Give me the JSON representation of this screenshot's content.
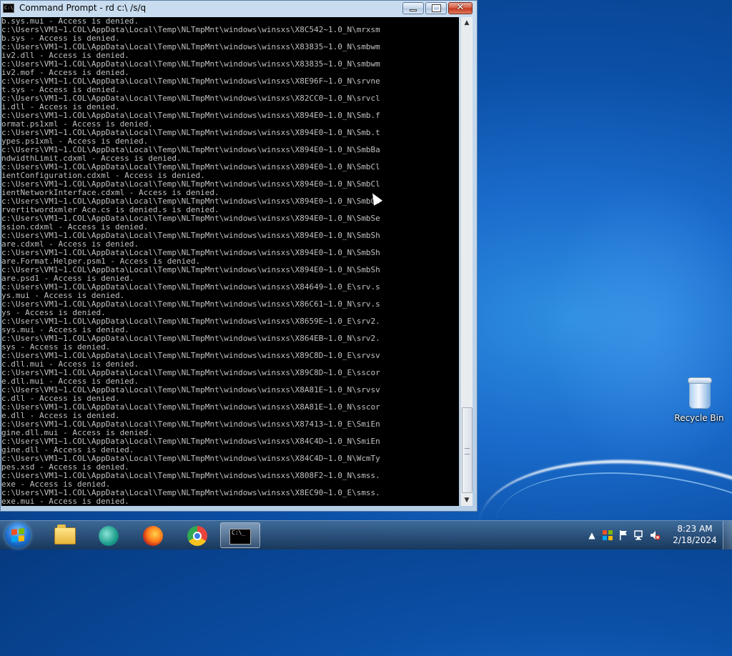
{
  "window": {
    "title": "Command Prompt - rd  c:\\ /s/q",
    "icon_name": "cmd-icon",
    "icon_text": "C:\\_"
  },
  "console": {
    "lines": [
      "b.sys.mui - Access is denied.",
      "c:\\Users\\VM1~1.COL\\AppData\\Local\\Temp\\NLTmpMnt\\windows\\winsxs\\X8C542~1.0_N\\mrxsm",
      "b.sys - Access is denied.",
      "c:\\Users\\VM1~1.COL\\AppData\\Local\\Temp\\NLTmpMnt\\windows\\winsxs\\X83835~1.0_N\\smbwm",
      "iv2.dll - Access is denied.",
      "c:\\Users\\VM1~1.COL\\AppData\\Local\\Temp\\NLTmpMnt\\windows\\winsxs\\X83835~1.0_N\\smbwm",
      "iv2.mof - Access is denied.",
      "c:\\Users\\VM1~1.COL\\AppData\\Local\\Temp\\NLTmpMnt\\windows\\winsxs\\X8E96F~1.0_N\\srvne",
      "t.sys - Access is denied.",
      "c:\\Users\\VM1~1.COL\\AppData\\Local\\Temp\\NLTmpMnt\\windows\\winsxs\\X82CC0~1.0_N\\srvcl",
      "i.dll - Access is denied.",
      "c:\\Users\\VM1~1.COL\\AppData\\Local\\Temp\\NLTmpMnt\\windows\\winsxs\\X894E0~1.0_N\\Smb.f",
      "ormat.ps1xml - Access is denied.",
      "c:\\Users\\VM1~1.COL\\AppData\\Local\\Temp\\NLTmpMnt\\windows\\winsxs\\X894E0~1.0_N\\Smb.t",
      "ypes.ps1xml - Access is denied.",
      "c:\\Users\\VM1~1.COL\\AppData\\Local\\Temp\\NLTmpMnt\\windows\\winsxs\\X894E0~1.0_N\\SmbBa",
      "ndwidthLimit.cdxml - Access is denied.",
      "c:\\Users\\VM1~1.COL\\AppData\\Local\\Temp\\NLTmpMnt\\windows\\winsxs\\X894E0~1.0_N\\SmbCl",
      "ientConfiguration.cdxml - Access is denied.",
      "c:\\Users\\VM1~1.COL\\AppData\\Local\\Temp\\NLTmpMnt\\windows\\winsxs\\X894E0~1.0_N\\SmbCl",
      "ientNetworkInterface.cdxml - Access is denied.",
      "c:\\Users\\VM1~1.COL\\AppData\\Local\\Temp\\NLTmpMnt\\windows\\winsxs\\X894E0~1.0_N\\SmbCo",
      "rvertitwordxmler Ace.cs is denied.s is denied.",
      "c:\\Users\\VM1~1.COL\\AppData\\Local\\Temp\\NLTmpMnt\\windows\\winsxs\\X894E0~1.0_N\\SmbSe",
      "ssion.cdxml - Access is denied.",
      "c:\\Users\\VM1~1.COL\\AppData\\Local\\Temp\\NLTmpMnt\\windows\\winsxs\\X894E0~1.0_N\\SmbSh",
      "are.cdxml - Access is denied.",
      "c:\\Users\\VM1~1.COL\\AppData\\Local\\Temp\\NLTmpMnt\\windows\\winsxs\\X894E0~1.0_N\\SmbSh",
      "are.Format.Helper.psm1 - Access is denied.",
      "c:\\Users\\VM1~1.COL\\AppData\\Local\\Temp\\NLTmpMnt\\windows\\winsxs\\X894E0~1.0_N\\SmbSh",
      "are.psd1 - Access is denied.",
      "c:\\Users\\VM1~1.COL\\AppData\\Local\\Temp\\NLTmpMnt\\windows\\winsxs\\X84649~1.0_E\\srv.s",
      "ys.mui - Access is denied.",
      "c:\\Users\\VM1~1.COL\\AppData\\Local\\Temp\\NLTmpMnt\\windows\\winsxs\\X86C61~1.0_N\\srv.s",
      "ys - Access is denied.",
      "c:\\Users\\VM1~1.COL\\AppData\\Local\\Temp\\NLTmpMnt\\windows\\winsxs\\X8659E~1.0_E\\srv2.",
      "sys.mui - Access is denied.",
      "c:\\Users\\VM1~1.COL\\AppData\\Local\\Temp\\NLTmpMnt\\windows\\winsxs\\X864EB~1.0_N\\srv2.",
      "sys - Access is denied.",
      "c:\\Users\\VM1~1.COL\\AppData\\Local\\Temp\\NLTmpMnt\\windows\\winsxs\\X89C8D~1.0_E\\srvsv",
      "c.dll.mui - Access is denied.",
      "c:\\Users\\VM1~1.COL\\AppData\\Local\\Temp\\NLTmpMnt\\windows\\winsxs\\X89C8D~1.0_E\\sscor",
      "e.dll.mui - Access is denied.",
      "c:\\Users\\VM1~1.COL\\AppData\\Local\\Temp\\NLTmpMnt\\windows\\winsxs\\X8A81E~1.0_N\\srvsv",
      "c.dll - Access is denied.",
      "c:\\Users\\VM1~1.COL\\AppData\\Local\\Temp\\NLTmpMnt\\windows\\winsxs\\X8A81E~1.0_N\\sscor",
      "e.dll - Access is denied.",
      "c:\\Users\\VM1~1.COL\\AppData\\Local\\Temp\\NLTmpMnt\\windows\\winsxs\\X87413~1.0_E\\SmiEn",
      "gine.dll.mui - Access is denied.",
      "c:\\Users\\VM1~1.COL\\AppData\\Local\\Temp\\NLTmpMnt\\windows\\winsxs\\X84C4D~1.0_N\\SmiEn",
      "gine.dll - Access is denied.",
      "c:\\Users\\VM1~1.COL\\AppData\\Local\\Temp\\NLTmpMnt\\windows\\winsxs\\X84C4D~1.0_N\\WcmTy",
      "pes.xsd - Access is denied.",
      "c:\\Users\\VM1~1.COL\\AppData\\Local\\Temp\\NLTmpMnt\\windows\\winsxs\\X808F2~1.0_N\\smss.",
      "exe - Access is denied.",
      "c:\\Users\\VM1~1.COL\\AppData\\Local\\Temp\\NLTmpMnt\\windows\\winsxs\\X8EC90~1.0_E\\smss.",
      "exe.mui - Access is denied."
    ],
    "scroll_position_fraction": 0.86
  },
  "desktop": {
    "recycle_bin_label": "Recycle Bin"
  },
  "taskbar": {
    "pinned": [
      {
        "name": "start-button",
        "icon": "windows-logo-icon"
      },
      {
        "name": "file-explorer",
        "icon": "folder-icon"
      },
      {
        "name": "internet-explorer",
        "icon": "ie-icon"
      },
      {
        "name": "firefox",
        "icon": "firefox-icon"
      },
      {
        "name": "chrome",
        "icon": "chrome-icon"
      },
      {
        "name": "command-prompt",
        "icon": "cmd-icon",
        "active": true
      }
    ],
    "cmd_icon_text": "C:\\_",
    "tray_icons": [
      "show-hidden-icons-icon",
      "action-center-icon",
      "flag-icon",
      "network-icon",
      "volume-muted-icon"
    ],
    "clock_time": "8:23 AM",
    "clock_date": "2/18/2024"
  },
  "colors": {
    "console_bg": "#000000",
    "console_fg": "#c0c0c0",
    "close_button": "#c3371c",
    "desktop_blue": "#1a6bcb"
  }
}
